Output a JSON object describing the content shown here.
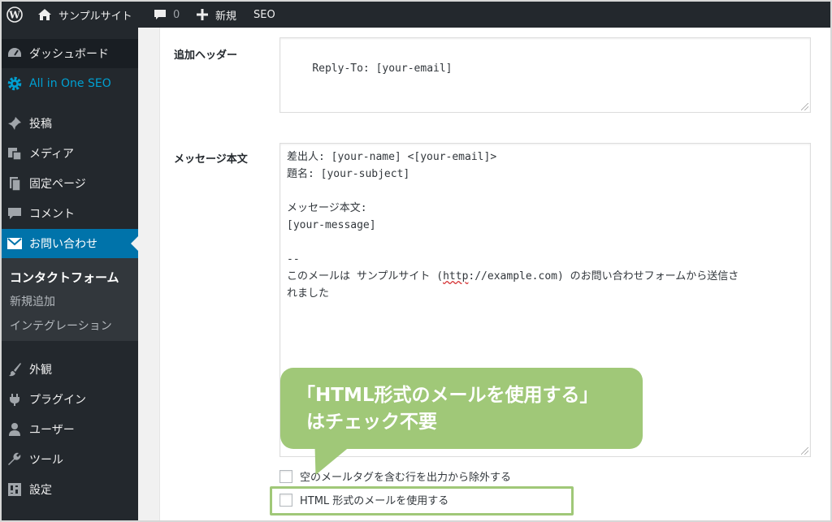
{
  "adminbar": {
    "site_name": "サンプルサイト",
    "comment_count": "0",
    "new_label": "新規",
    "seo_label": "SEO"
  },
  "sidebar": {
    "items": [
      {
        "label": "ダッシュボード",
        "icon": "dashboard-icon"
      },
      {
        "label": "All in One SEO",
        "icon": "gear-icon"
      },
      {
        "label": "投稿",
        "icon": "pin-icon"
      },
      {
        "label": "メディア",
        "icon": "media-icon"
      },
      {
        "label": "固定ページ",
        "icon": "page-icon"
      },
      {
        "label": "コメント",
        "icon": "comment-icon"
      },
      {
        "label": "お問い合わせ",
        "icon": "mail-icon"
      },
      {
        "label": "外観",
        "icon": "brush-icon"
      },
      {
        "label": "プラグイン",
        "icon": "plugin-icon"
      },
      {
        "label": "ユーザー",
        "icon": "user-icon"
      },
      {
        "label": "ツール",
        "icon": "wrench-icon"
      },
      {
        "label": "設定",
        "icon": "settings-icon"
      }
    ],
    "submenu": [
      "コンタクトフォーム",
      "新規追加",
      "インテグレーション"
    ]
  },
  "form": {
    "header_label": "追加ヘッダー",
    "header_value": "Reply-To: [your-email]",
    "body_label": "メッセージ本文",
    "body_lines": [
      "差出人: [your-name] <[your-email]>",
      "題名: [your-subject]",
      "",
      "メッセージ本文:",
      "[your-message]",
      "",
      "--"
    ],
    "body_line8_pre": "このメールは サンプルサイト (",
    "body_line8_http": "http",
    "body_line8_post": "://example.com) のお問い合わせフォームから送信さ",
    "body_line9": "れました",
    "checkbox_exclude": "空のメールタグを含む行を出力から除外する",
    "checkbox_html": "HTML 形式のメールを使用する"
  },
  "annotation": {
    "line1": "「HTML形式のメールを使用する」",
    "line2": "はチェック不要",
    "color": "#a0c878"
  },
  "colors": {
    "adminbar_bg": "#23282d",
    "sidebar_current": "#0073aa",
    "aioseo_accent": "#00a0d2"
  }
}
